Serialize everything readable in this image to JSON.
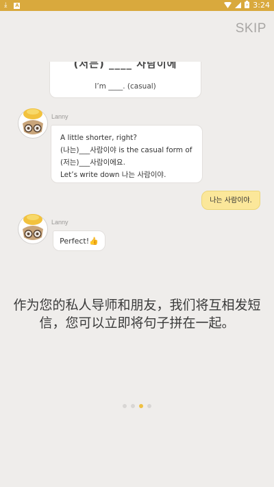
{
  "status_bar": {
    "time": "3:24",
    "left_icons": [
      "download-icon",
      "app-notification-icon"
    ],
    "right_icons": [
      "wifi-icon",
      "signal-icon",
      "battery-icon"
    ],
    "accent_color": "#d9a93d"
  },
  "skip_label": "SKIP",
  "chat": {
    "top_bubble": {
      "cut_text": "(저는) ____ 사람이에",
      "line": "I’m ____. (casual)"
    },
    "message_1": {
      "sender": "Lanny",
      "lines": [
        "A little shorter, right?",
        "(나는)___사람이야 is the casual form of",
        "(저는)___사람이에요.",
        "Let’s write down 나는 사람이야."
      ]
    },
    "user_message": {
      "text": "나는 사람이야."
    },
    "message_2": {
      "sender": "Lanny",
      "text": "Perfect!",
      "emoji": "👍"
    }
  },
  "caption": "作为您的私人导师和朋友，我们将互相发短信，您可以立即将句子拼在一起。",
  "pager": {
    "count": 4,
    "active_index": 2,
    "active_color": "#efc042"
  }
}
